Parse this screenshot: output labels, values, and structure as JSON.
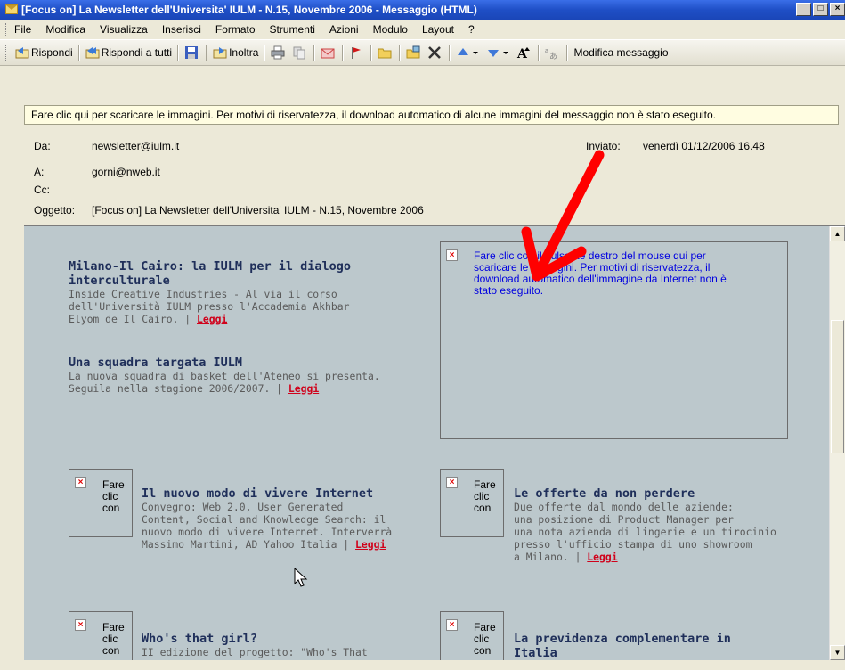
{
  "window": {
    "title": "[Focus on] La Newsletter dell'Universita' IULM - N.15, Novembre 2006 - Messaggio (HTML)",
    "buttons": [
      "_",
      "□",
      "×"
    ]
  },
  "menu": [
    "File",
    "Modifica",
    "Visualizza",
    "Inserisci",
    "Formato",
    "Strumenti",
    "Azioni",
    "Modulo",
    "Layout",
    "?"
  ],
  "toolbar": {
    "reply": "Rispondi",
    "reply_all": "Rispondi a tutti",
    "forward": "Inoltra",
    "edit": "Modifica messaggio"
  },
  "infobar": "Fare clic qui per scaricare le immagini. Per motivi di riservatezza, il download automatico di alcune immagini del messaggio non è stato eseguito.",
  "header": {
    "from_label": "Da:",
    "from": "newsletter@iulm.it",
    "sent_label": "Inviato:",
    "sent": "venerdì 01/12/2006 16.48",
    "to_label": "A:",
    "to": "gorni@nweb.it",
    "cc_label": "Cc:",
    "cc": "",
    "subject_label": "Oggetto:",
    "subject": "[Focus on] La Newsletter dell'Universita' IULM - N.15, Novembre 2006"
  },
  "main_placeholder": {
    "line1": "Fare clic con il pulsante destro del mouse qui per",
    "line2": "scaricare le immagini. Per motivi di riservatezza, il",
    "line3": "download automatico dell'immagine da Internet non è",
    "line4": "stato eseguito."
  },
  "small_placeholder": {
    "l1": "Fare",
    "l2": "clic",
    "l3": "con"
  },
  "leggi": "Leggi",
  "articles": {
    "a1": {
      "title1": "Milano-Il Cairo: la IULM per il dialogo",
      "title2": "interculturale",
      "l1": "Inside Creative Industries - Al via il corso",
      "l2": "dell'Università IULM presso l'Accademia Akhbar",
      "l3": "Elyom de Il Cairo. |"
    },
    "a2": {
      "title": "Una squadra targata IULM",
      "l1": "La nuova squadra di basket dell'Ateneo si presenta.",
      "l2": "Seguila nella stagione 2006/2007. |"
    },
    "a3": {
      "title": "Il nuovo modo di vivere Internet",
      "l1": "Convegno: Web 2.0, User Generated",
      "l2": "Content, Social and Knowledge Search: il",
      "l3": "nuovo modo di vivere Internet. Interverrà",
      "l4": "Massimo Martini, AD Yahoo Italia |"
    },
    "a4": {
      "title": "Le offerte da non perdere",
      "l1": "Due offerte dal mondo delle aziende:",
      "l2": "una posizione di Product Manager per",
      "l3": "una nota azienda di lingerie e un tirocinio",
      "l4": "presso l'ufficio stampa di uno showroom",
      "l5": "a Milano. |"
    },
    "a5": {
      "title": "Who's that girl?",
      "l1": "II edizione del progetto: \"Who's That"
    },
    "a6": {
      "title1": "La previdenza complementare in",
      "title2": "Italia"
    }
  },
  "colors": {
    "title_bar": "#1f4fc6",
    "body_bg": "#bcc8cc",
    "link_red": "#d0021b",
    "annotation_arrow": "#ff0000"
  }
}
